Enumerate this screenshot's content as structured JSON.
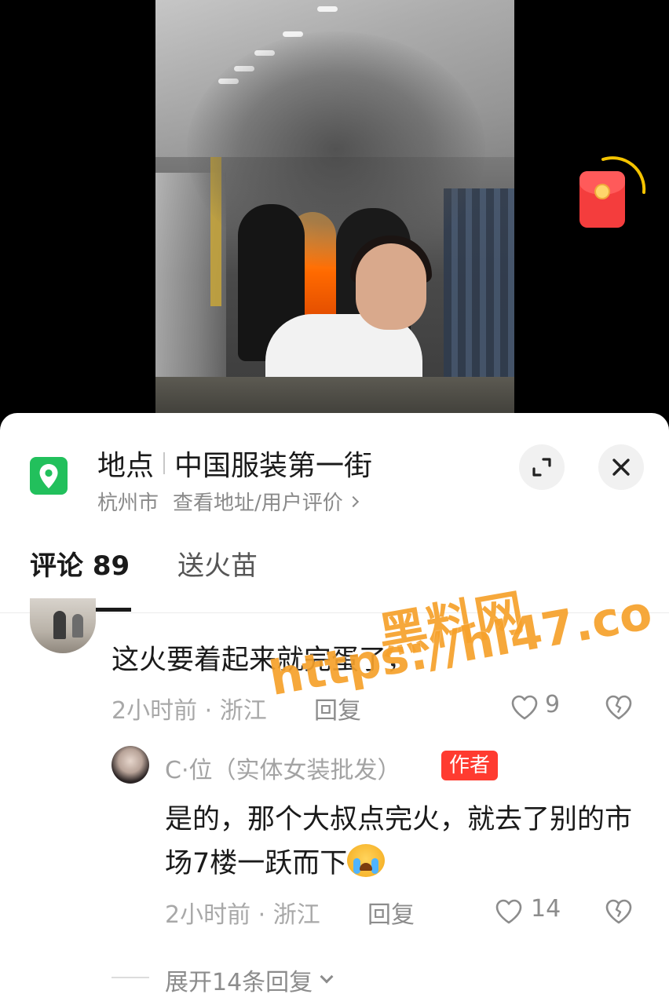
{
  "location": {
    "label": "地点",
    "name": "中国服装第一街",
    "city": "杭州市",
    "link": "查看地址/用户评价"
  },
  "tabs": [
    {
      "label": "评论 89",
      "active": true
    },
    {
      "label": "送火苗",
      "active": false
    }
  ],
  "comments": [
    {
      "text": "这火要着起来就完蛋了，",
      "meta": "2小时前 · 浙江",
      "reply_label": "回复",
      "likes": "9"
    }
  ],
  "reply": {
    "author": "C·位（实体女装批发）",
    "badge": "作者",
    "text": "是的，那个大叔点完火，就去了别的市场7楼一跃而下",
    "meta": "2小时前 · 浙江",
    "reply_label": "回复",
    "likes": "14"
  },
  "expand_replies": "展开14条回复",
  "watermark": {
    "title": "黑料网",
    "url": "https://hl47.co"
  },
  "colors": {
    "location_icon": "#22c05c",
    "author_badge": "#ff3b30",
    "watermark": "#f6a12b",
    "red_packet": "#f43d3d"
  }
}
